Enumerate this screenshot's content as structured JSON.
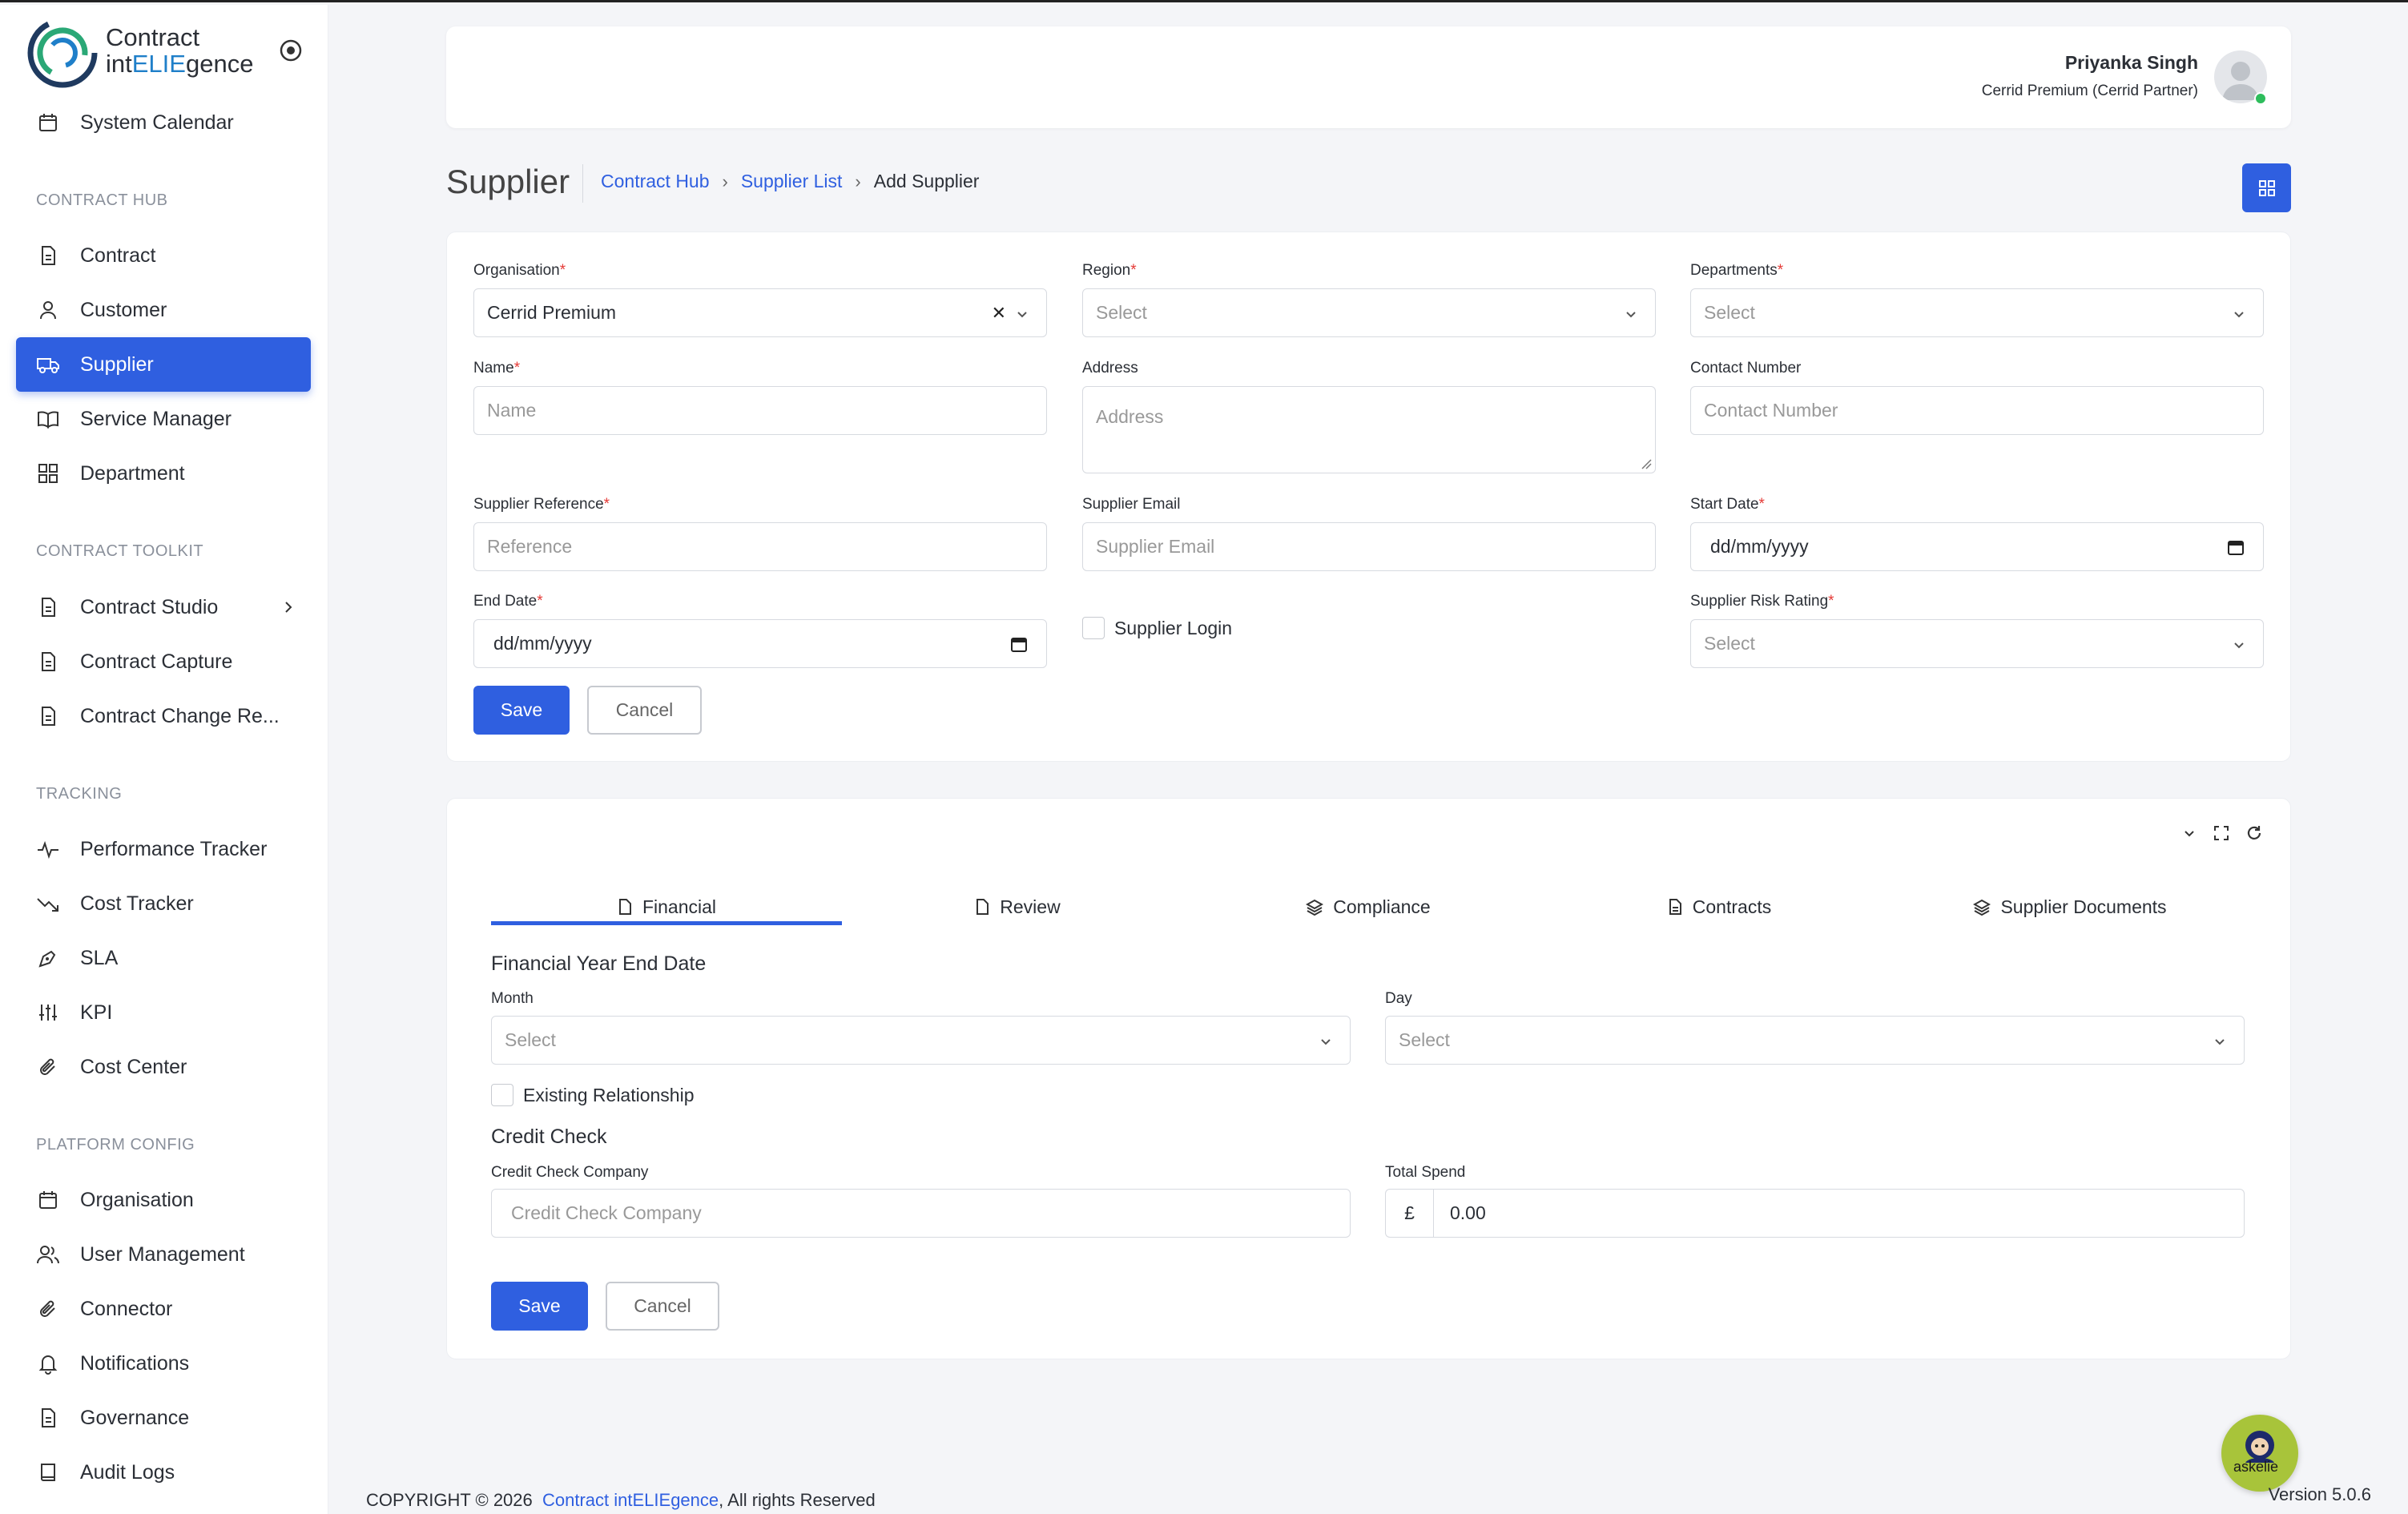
{
  "app": {
    "logo_line1": "Contract",
    "logo_line2_a": "int",
    "logo_line2_b": "ELIE",
    "logo_line2_c": "gence",
    "accent": "#2f5fe0"
  },
  "sidebar": {
    "top_item": "System Calendar",
    "sections": {
      "hub": "CONTRACT HUB",
      "toolkit": "CONTRACT TOOLKIT",
      "tracking": "TRACKING",
      "platform": "PLATFORM CONFIG"
    },
    "hub_items": [
      "Contract",
      "Customer",
      "Supplier",
      "Service Manager",
      "Department"
    ],
    "toolkit_items": [
      "Contract Studio",
      "Contract Capture",
      "Contract Change Re..."
    ],
    "tracking_items": [
      "Performance Tracker",
      "Cost Tracker",
      "SLA",
      "KPI",
      "Cost Center"
    ],
    "platform_items": [
      "Organisation",
      "User Management",
      "Connector",
      "Notifications",
      "Governance",
      "Audit Logs"
    ]
  },
  "header": {
    "user_name": "Priyanka Singh",
    "user_role": "Cerrid Premium (Cerrid Partner)"
  },
  "page": {
    "title": "Supplier",
    "breadcrumb": [
      "Contract Hub",
      "Supplier List",
      "Add Supplier"
    ]
  },
  "form": {
    "organisation": {
      "label": "Organisation",
      "value": "Cerrid Premium"
    },
    "region": {
      "label": "Region",
      "placeholder": "Select"
    },
    "departments": {
      "label": "Departments",
      "placeholder": "Select"
    },
    "name": {
      "label": "Name",
      "placeholder": "Name"
    },
    "address": {
      "label": "Address",
      "placeholder": "Address"
    },
    "contact_number": {
      "label": "Contact Number",
      "placeholder": "Contact Number"
    },
    "supplier_reference": {
      "label": "Supplier Reference",
      "placeholder": "Reference"
    },
    "supplier_email": {
      "label": "Supplier Email",
      "placeholder": "Supplier Email"
    },
    "start_date": {
      "label": "Start Date",
      "value": "dd/mm/yyyy"
    },
    "end_date": {
      "label": "End Date",
      "value": "dd/mm/yyyy"
    },
    "supplier_login": "Supplier Login",
    "risk_rating": {
      "label": "Supplier Risk Rating",
      "placeholder": "Select"
    },
    "save": "Save",
    "cancel": "Cancel",
    "required_mark": "*"
  },
  "tabs": [
    "Financial",
    "Review",
    "Compliance",
    "Contracts",
    "Supplier Documents"
  ],
  "financial": {
    "fy_heading": "Financial Year End Date",
    "month": {
      "label": "Month",
      "placeholder": "Select"
    },
    "day": {
      "label": "Day",
      "placeholder": "Select"
    },
    "existing_relationship": "Existing Relationship",
    "credit_heading": "Credit Check",
    "credit_company": {
      "label": "Credit Check Company",
      "placeholder": "Credit Check Company"
    },
    "total_spend": {
      "label": "Total Spend",
      "currency": "£",
      "value": "0.00"
    },
    "save": "Save",
    "cancel": "Cancel"
  },
  "footer": {
    "copyright": "COPYRIGHT © 2026",
    "brand": "Contract intELIEgence",
    "rights": ", All rights Reserved",
    "version": "Version 5.0.6",
    "assistant": "askelie"
  }
}
